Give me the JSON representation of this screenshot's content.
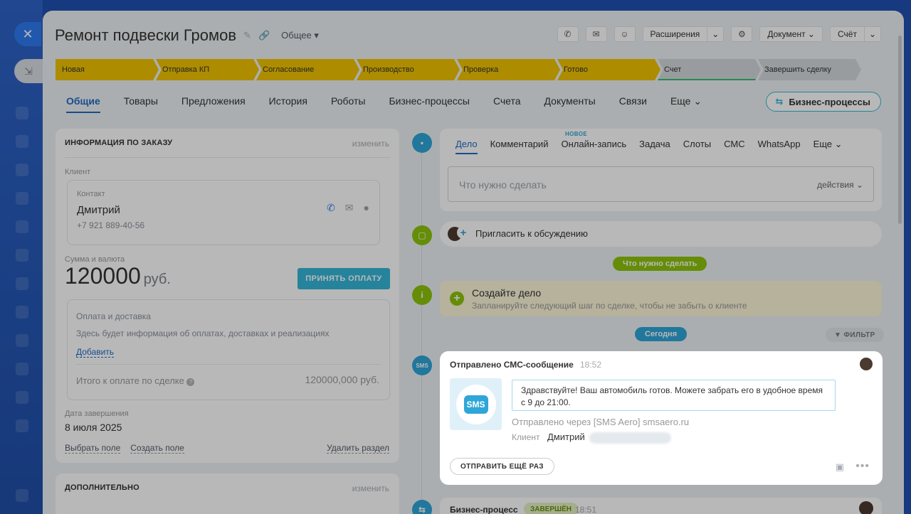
{
  "header": {
    "title": "Ремонт подвески Громов",
    "category": "Общее",
    "extensions_label": "Расширения",
    "document_label": "Документ",
    "invoice_label": "Счёт"
  },
  "stages": [
    {
      "label": "Новая"
    },
    {
      "label": "Отправка КП"
    },
    {
      "label": "Согласование"
    },
    {
      "label": "Производство"
    },
    {
      "label": "Проверка"
    },
    {
      "label": "Готово"
    },
    {
      "label": "Счет"
    },
    {
      "label": "Завершить сделку"
    }
  ],
  "tabs": [
    "Общие",
    "Товары",
    "Предложения",
    "История",
    "Роботы",
    "Бизнес-процессы",
    "Счета",
    "Документы",
    "Связи",
    "Еще"
  ],
  "bp_button": "Бизнес-процессы",
  "order_info": {
    "title": "ИНФОРМАЦИЯ ПО ЗАКАЗУ",
    "edit": "изменить",
    "client_label": "Клиент",
    "contact_label": "Контакт",
    "contact_name": "Дмитрий",
    "contact_phone": "+7 921 889-40-56",
    "amount_label": "Сумма и валюта",
    "amount": "120000",
    "currency": "руб.",
    "pay_button": "ПРИНЯТЬ ОПЛАТУ",
    "payment_title": "Оплата и доставка",
    "payment_desc": "Здесь будет информация об оплатах, доставках и реализациях",
    "payment_add": "Добавить",
    "total_label": "Итого к оплате по сделке",
    "total_value": "120000,000 руб.",
    "date_label": "Дата завершения",
    "date_value": "8 июля 2025",
    "select_field": "Выбрать поле",
    "create_field": "Создать поле",
    "delete_section": "Удалить раздел"
  },
  "additional": {
    "title": "ДОПОЛНИТЕЛЬНО",
    "edit": "изменить"
  },
  "editor": {
    "tabs": [
      "Дело",
      "Комментарий",
      "Онлайн-запись",
      "Задача",
      "Слоты",
      "СМС",
      "WhatsApp",
      "Еще"
    ],
    "new_badge": "НОВОЕ",
    "placeholder": "Что нужно сделать",
    "actions": "действия"
  },
  "invite": "Пригласить к обсуждению",
  "todo_pill": "Что нужно сделать",
  "todo": {
    "title": "Создайте дело",
    "desc": "Запланируйте следующий шаг по сделке, чтобы не забыть о клиенте"
  },
  "today_pill": "Сегодня",
  "filter": "ФИЛЬТР",
  "sms": {
    "title": "Отправлено СМС-сообщение",
    "time": "18:52",
    "logo_text": "SMS",
    "message": "Здравствуйте! Ваш автомобиль готов. Можете забрать его в удобное время с 9 до 21:00.",
    "via": "Отправлено через [SMS Aero] smsaero.ru",
    "client_label": "Клиент",
    "client_name": "Дмитрий",
    "resend": "ОТПРАВИТЬ ЕЩЁ РАЗ",
    "more": "•••",
    "icon_label": "SMS"
  },
  "bp_event": {
    "title": "Бизнес-процесс",
    "status": "ЗАВЕРШЁН",
    "time": "18:51"
  },
  "colors": {
    "accent": "#1f6bc4",
    "stage": "#f0c200",
    "teal": "#35b6d9",
    "green": "#8cc40b"
  }
}
